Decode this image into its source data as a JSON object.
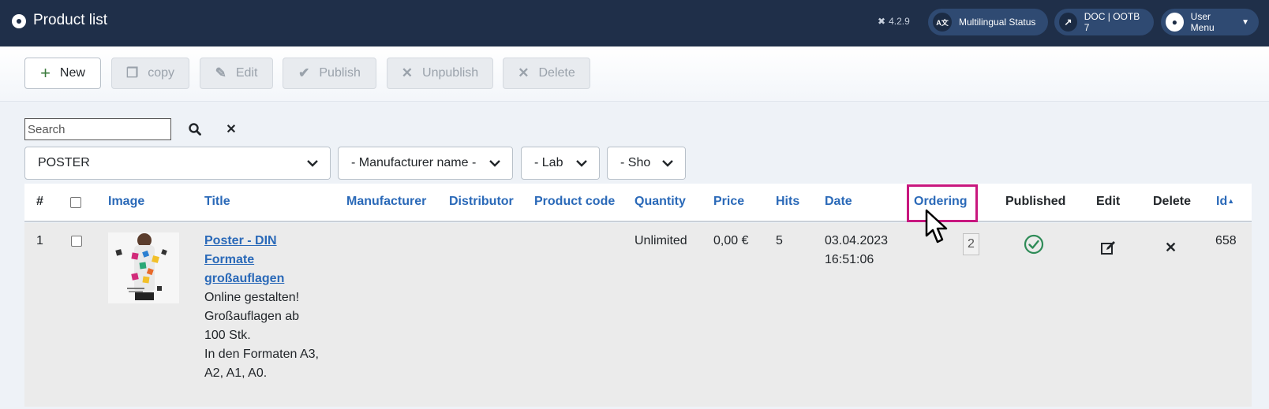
{
  "header": {
    "title": "Product list",
    "version": "4.2.9",
    "buttons": {
      "multilingual": "Multilingual Status",
      "doc": "DOC | OOTB 7",
      "user": "User Menu"
    }
  },
  "toolbar": {
    "new": "New",
    "copy": "copy",
    "edit": "Edit",
    "publish": "Publish",
    "unpublish": "Unpublish",
    "delete": "Delete"
  },
  "filters": {
    "search_placeholder": "Search",
    "search_value": "",
    "category": "POSTER",
    "manufacturer": "- Manufacturer name -",
    "lab": "- Lab",
    "sho": "- Sho"
  },
  "table": {
    "columns": {
      "num": "#",
      "image": "Image",
      "title": "Title",
      "manufacturer": "Manufacturer",
      "distributor": "Distributor",
      "product_code": "Product code",
      "quantity": "Quantity",
      "price": "Price",
      "hits": "Hits",
      "date": "Date",
      "ordering": "Ordering",
      "published": "Published",
      "edit": "Edit",
      "delete": "Delete",
      "id": "Id"
    },
    "rows": [
      {
        "num": "1",
        "title_lines": [
          "Poster - DIN",
          "Formate",
          "großauflagen"
        ],
        "desc_lines": [
          "Online gestalten!",
          "Großauflagen ab",
          "100 Stk.",
          "In den Formaten A3,",
          "A2, A1, A0."
        ],
        "quantity": "Unlimited",
        "price": "0,00 €",
        "hits": "5",
        "date": "03.04.2023",
        "time": "16:51:06",
        "ordering": "2",
        "published": true,
        "id": "658"
      }
    ]
  },
  "colors": {
    "header_bg": "#1f2f49",
    "link_blue": "#2a69b8",
    "published_green": "#2e8b57",
    "highlight_magenta": "#c8177e"
  }
}
